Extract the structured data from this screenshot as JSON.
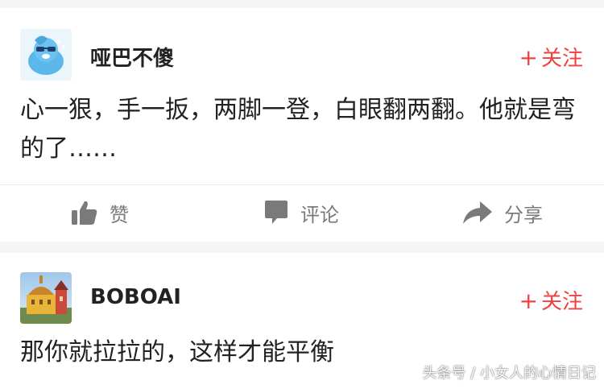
{
  "posts": [
    {
      "username": "哑巴不傻",
      "follow_label": "关注",
      "content": "心一狠，手一扳，两脚一登，白眼翻两翻。他就是弯的了……",
      "actions": {
        "like_label": "赞",
        "comment_label": "评论",
        "share_label": "分享"
      }
    },
    {
      "username": "BOBOAI",
      "follow_label": "关注",
      "content": "那你就拉拉的，这样才能平衡"
    }
  ],
  "watermark": "头条号 / 小女人的心情日记",
  "colors": {
    "accent": "#f04142",
    "background": "#f4f5f6",
    "card": "#ffffff",
    "action_text": "#7a7a7a"
  },
  "icons": {
    "follow": "plus-icon",
    "like": "thumbs-up-icon",
    "comment": "speech-bubble-icon",
    "share": "share-arrow-icon"
  }
}
